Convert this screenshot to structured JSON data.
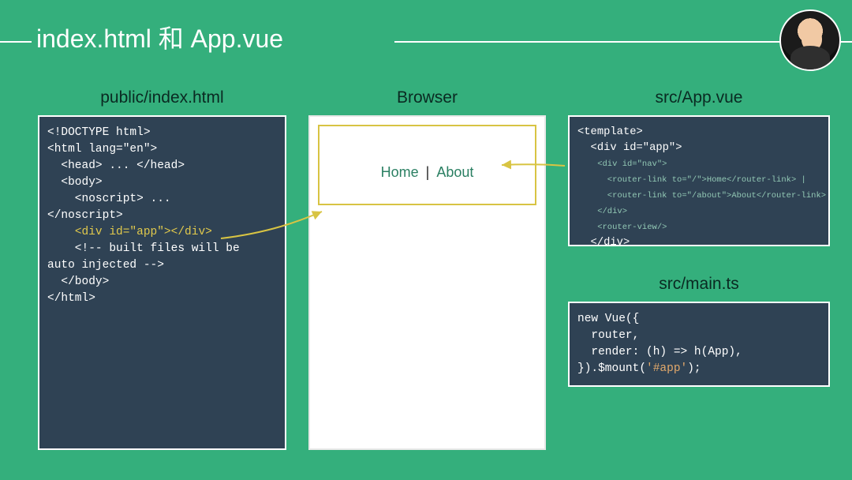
{
  "title": "index.html 和 App.vue",
  "left": {
    "label": "public/index.html",
    "code": "<!DOCTYPE html>\n<html lang=\"en\">\n  <head> ... </head>\n  <body>\n    <noscript> ...\n</noscript>\n    <div id=\"app\"></div>\n    <!-- built files will be\nauto injected -->\n  </body>\n</html>",
    "highlight": "<div id=\"app\"></div>"
  },
  "center": {
    "label": "Browser",
    "link_home": "Home",
    "link_about": "About",
    "separator": "|"
  },
  "right": {
    "appvue_label": "src/App.vue",
    "appvue_outer_open": "<template>\n  <div id=\"app\">",
    "appvue_inner": "    <div id=\"nav\">\n      <router-link to=\"/\">Home</router-link> |\n      <router-link to=\"/about\">About</router-link>\n    </div>\n    <router-view/>",
    "appvue_outer_close": "  </div>\n</template>",
    "maints_label": "src/main.ts",
    "maints_code_prefix": "new Vue({\n  router,\n  render: (h) => h(App),\n}).$mount(",
    "maints_code_arg": "'#app'",
    "maints_code_suffix": ");"
  }
}
